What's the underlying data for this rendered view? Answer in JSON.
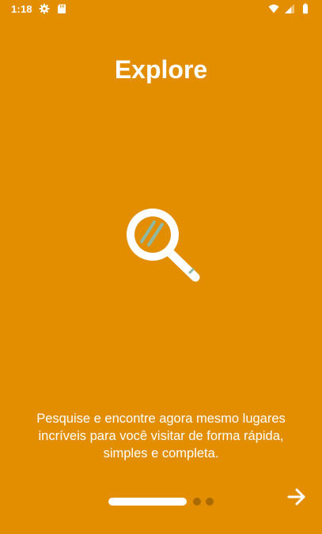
{
  "status_bar": {
    "time": "1:18",
    "left_icons": [
      "gear-icon",
      "sd-card-icon"
    ],
    "right_icons": [
      "wifi-icon",
      "signal-icon",
      "battery-icon"
    ]
  },
  "onboarding": {
    "title": "Explore",
    "illustration_icon": "magnifying-glass-icon",
    "description": "Pesquise e encontre agora mesmo lugares incríveis para você visitar de forma rápida, simples e completa.",
    "page_count": 3,
    "current_page": 1,
    "next_icon": "arrow-right-icon"
  },
  "colors": {
    "background": "#E28E00",
    "text": "#FFFFFF",
    "dot_inactive": "#A96A00",
    "lens_glare": "#8FB9A2"
  }
}
